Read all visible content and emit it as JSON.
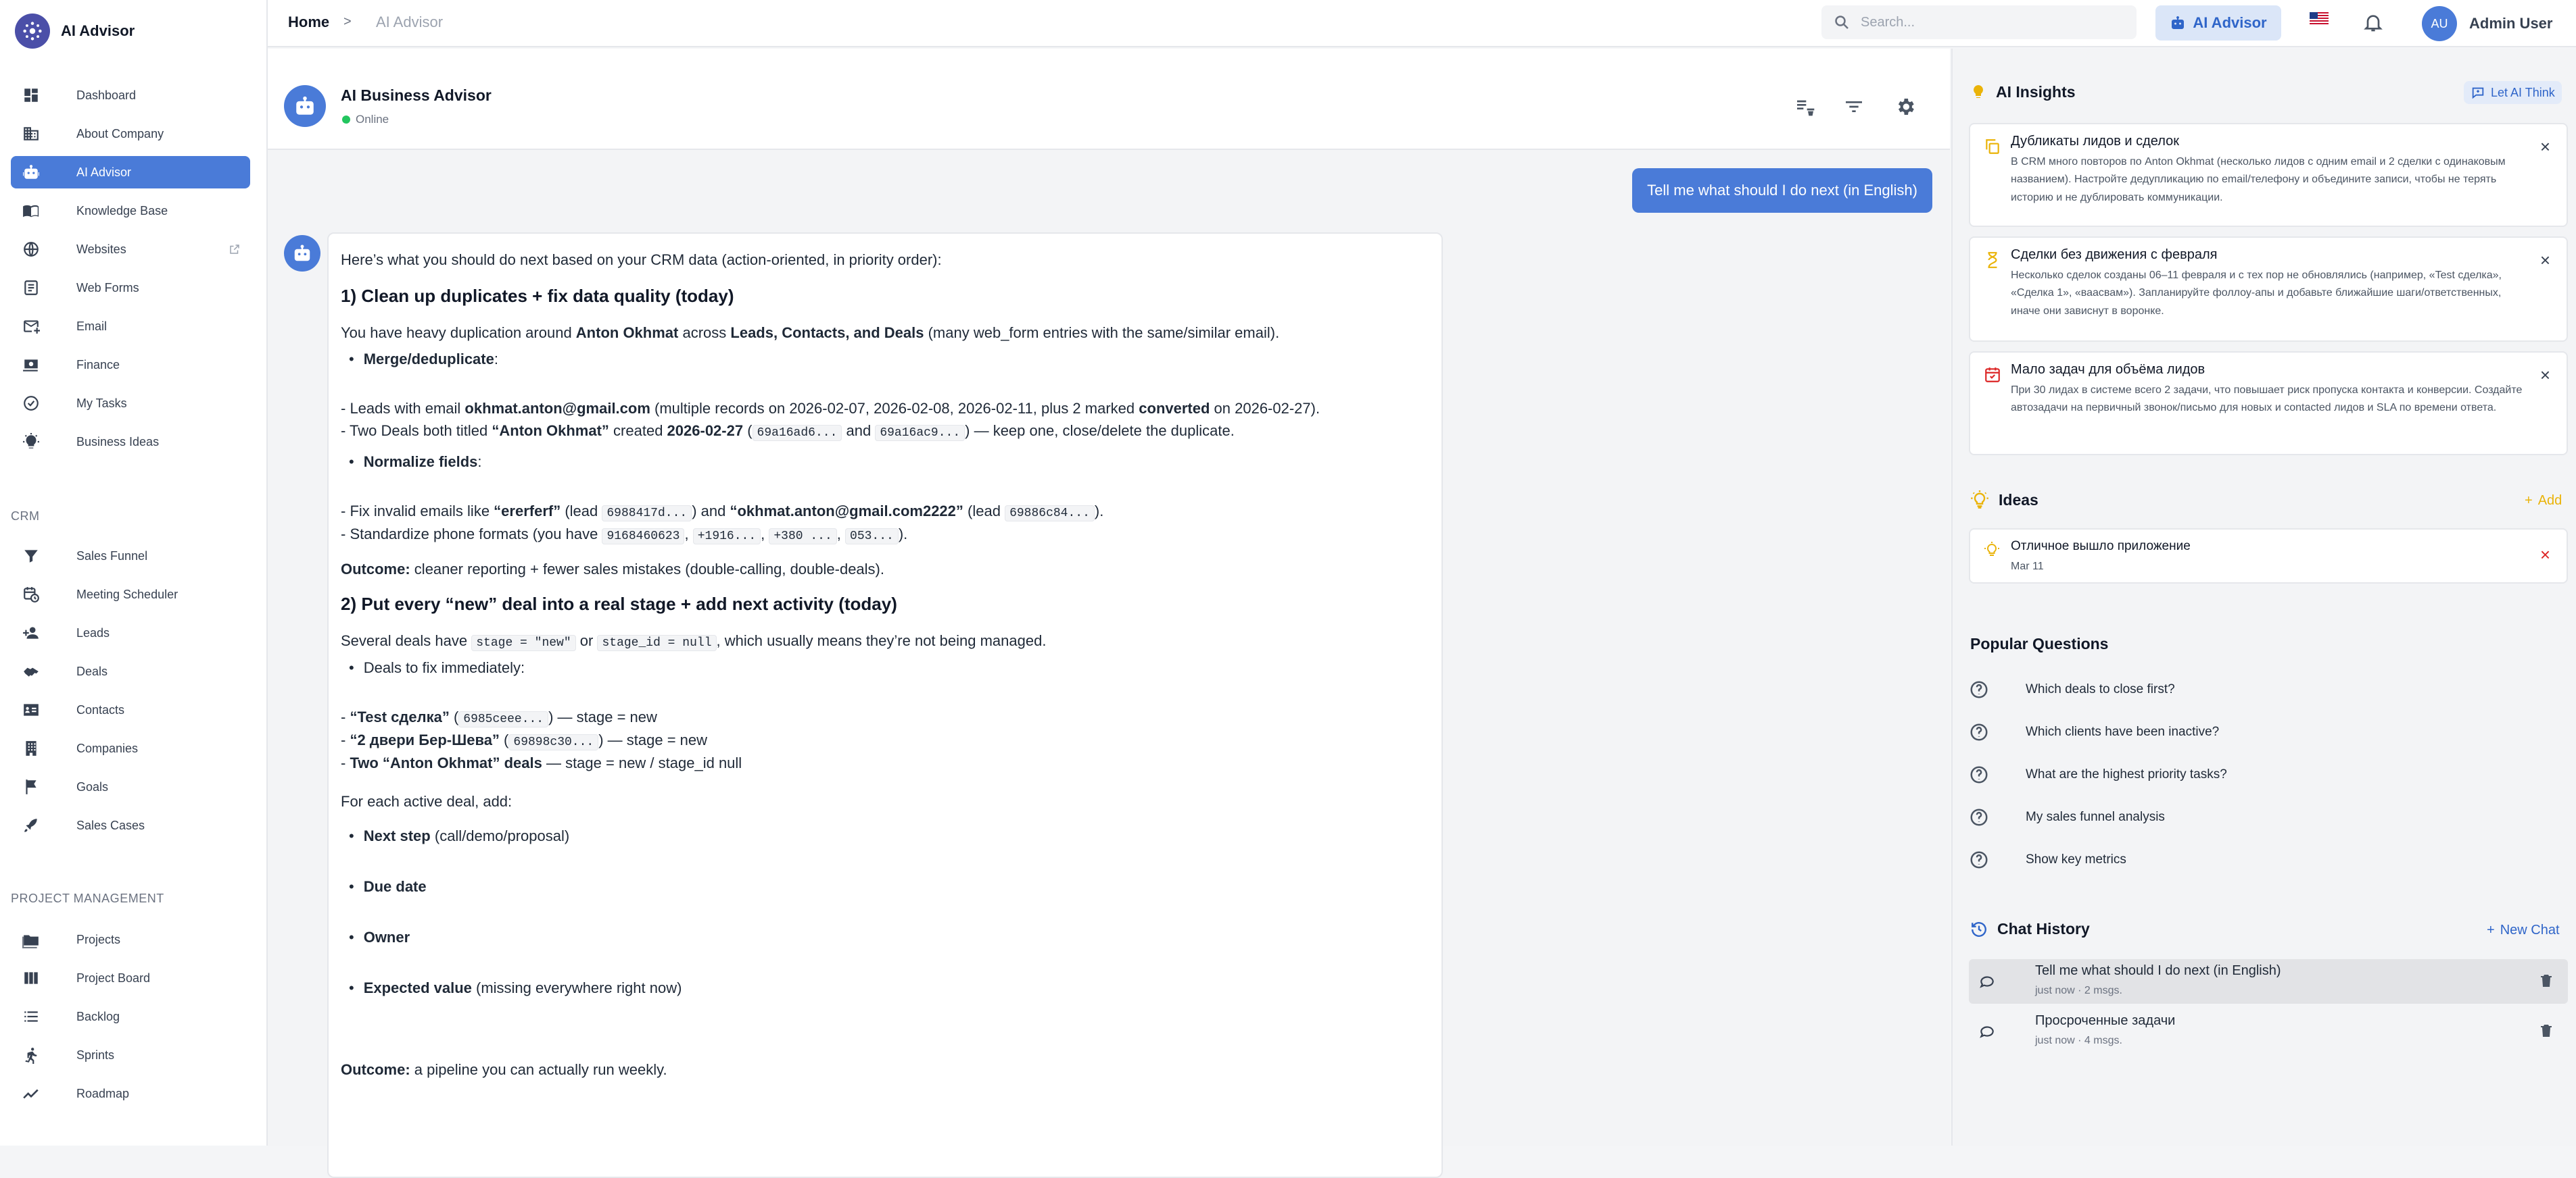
{
  "app": {
    "name": "AI Advisor"
  },
  "sidebar": {
    "items": [
      {
        "label": "Dashboard",
        "icon": "dashboard-icon"
      },
      {
        "label": "About Company",
        "icon": "building-icon"
      },
      {
        "label": "AI Advisor",
        "icon": "robot-icon",
        "active": true
      },
      {
        "label": "Knowledge Base",
        "icon": "book-icon"
      },
      {
        "label": "Websites",
        "icon": "globe-icon",
        "external": true
      },
      {
        "label": "Web Forms",
        "icon": "form-icon"
      },
      {
        "label": "Email",
        "icon": "email-icon"
      },
      {
        "label": "Finance",
        "icon": "money-icon"
      },
      {
        "label": "My Tasks",
        "icon": "check-circle-icon"
      },
      {
        "label": "Business Ideas",
        "icon": "lightbulb-icon"
      }
    ],
    "crm_title": "CRM",
    "crm_items": [
      {
        "label": "Sales Funnel",
        "icon": "funnel-icon"
      },
      {
        "label": "Meeting Scheduler",
        "icon": "calendar-clock-icon"
      },
      {
        "label": "Leads",
        "icon": "person-add-icon"
      },
      {
        "label": "Deals",
        "icon": "handshake-icon"
      },
      {
        "label": "Contacts",
        "icon": "contact-card-icon"
      },
      {
        "label": "Companies",
        "icon": "company-icon"
      },
      {
        "label": "Goals",
        "icon": "flag-icon"
      },
      {
        "label": "Sales Cases",
        "icon": "rocket-icon"
      }
    ],
    "pm_title": "PROJECT MANAGEMENT",
    "pm_items": [
      {
        "label": "Projects",
        "icon": "folder-icon"
      },
      {
        "label": "Project Board",
        "icon": "board-icon"
      },
      {
        "label": "Backlog",
        "icon": "list-icon"
      },
      {
        "label": "Sprints",
        "icon": "runner-icon"
      },
      {
        "label": "Roadmap",
        "icon": "trend-icon"
      }
    ]
  },
  "topbar": {
    "breadcrumb_home": "Home",
    "breadcrumb_sep": ">",
    "breadcrumb_current": "AI Advisor",
    "search_placeholder": "Search...",
    "ai_button": "AI Advisor",
    "avatar_initials": "AU",
    "user_name": "Admin User"
  },
  "chat": {
    "title": "AI Business Advisor",
    "status": "Online",
    "user_message": "Tell me what should I do next (in English)",
    "reply": {
      "intro": "Here’s what you should do next based on your CRM data (action-oriented, in priority order):",
      "h1": "1) Clean up duplicates + fix data quality (today)",
      "p1_a": "You have heavy duplication around ",
      "p1_b": "Anton Okhmat",
      "p1_c": " across ",
      "p1_d": "Leads, Contacts, and Deals",
      "p1_e": " (many web_form entries with the same/similar email).",
      "b_merge": "Merge/deduplicate",
      "b_merge_colon": ":",
      "l1_a": "- Leads with email ",
      "l1_b": "okhmat.anton@gmail.com",
      "l1_c": " (multiple records on 2026-02-07, 2026-02-08, 2026-02-11, plus 2 marked ",
      "l1_d": "converted",
      "l1_e": " on 2026-02-27).",
      "l2_a": "- Two Deals both titled ",
      "l2_b": "“Anton Okhmat”",
      "l2_c": " created ",
      "l2_d": "2026-02-27",
      "l2_e": " (",
      "l2_code1": "69a16ad6...",
      "l2_f": " and ",
      "l2_code2": "69a16ac9...",
      "l2_g": ") — keep one, close/delete the duplicate.",
      "b_norm": "Normalize fields",
      "b_norm_colon": ":",
      "l3_a": "- Fix invalid emails like ",
      "l3_b": "“ererferf”",
      "l3_c": " (lead ",
      "l3_code1": "6988417d...",
      "l3_d": ") and ",
      "l3_e": "“okhmat.anton@gmail.com2222”",
      "l3_f": " (lead ",
      "l3_code2": "69886c84...",
      "l3_g": ").",
      "l4_a": "- Standardize phone formats (you have ",
      "l4_code1": "9168460623",
      "l4_s1": ", ",
      "l4_code2": "+1916...",
      "l4_s2": ", ",
      "l4_code3": "+380 ...",
      "l4_s3": ", ",
      "l4_code4": "053...",
      "l4_b": ").",
      "o1_a": "Outcome:",
      "o1_b": " cleaner reporting + fewer sales mistakes (double-calling, double-deals).",
      "h2": "2) Put every “new” deal into a real stage + add next activity (today)",
      "p2_a": "Several deals have ",
      "p2_code1": "stage = \"new\"",
      "p2_b": " or ",
      "p2_code2": "stage_id = null",
      "p2_c": ", which usually means they’re not being managed.",
      "b_deals": "Deals to fix immediately:",
      "d1_a": "- ",
      "d1_b": "“Test сделка”",
      "d1_c": " (",
      "d1_code": "6985ceee...",
      "d1_d": ") — stage = new",
      "d2_a": "- ",
      "d2_b": "“2 двери Бер-Шева”",
      "d2_c": " (",
      "d2_code": "69898c30...",
      "d2_d": ") — stage = new",
      "d3_a": "- ",
      "d3_b": "Two “Anton Okhmat” deals",
      "d3_c": " — stage = new / stage_id null",
      "p3": "For each active deal, add:",
      "b_next_a": "Next step",
      "b_next_b": " (call/demo/proposal)",
      "b_due": "Due date",
      "b_owner": "Owner",
      "b_val_a": "Expected value",
      "b_val_b": " (missing everywhere right now)",
      "o2_a": "Outcome:",
      "o2_b": " a pipeline you can actually run weekly."
    }
  },
  "insights": {
    "title": "AI Insights",
    "action": "Let AI Think",
    "cards": [
      {
        "title": "Дубликаты лидов и сделок",
        "text": "В CRM много повторов по Anton Okhmat (несколько лидов с одним email и 2 сделки с одинаковым названием). Настройте дедупликацию по email/телефону и объедините записи, чтобы не терять историю и не дублировать коммуникации."
      },
      {
        "title": "Сделки без движения с февраля",
        "text": "Несколько сделок созданы 06–11 февраля и с тех пор не обновлялись (например, «Test сделка», «Сделка 1», «ваасвам»). Запланируйте фоллоу-апы и добавьте ближайшие шаги/ответственных, иначе они зависнут в воронке."
      },
      {
        "title": "Мало задач для объёма лидов",
        "text": "При 30 лидах в системе всего 2 задачи, что повышает риск пропуска контакта и конверсии. Создайте автозадачи на первичный звонок/письмо для новых и contacted лидов и SLA по времени ответа."
      }
    ]
  },
  "ideas": {
    "title": "Ideas",
    "action": "Add",
    "items": [
      {
        "title": "Отличное вышло приложение",
        "date": "Mar 11"
      }
    ]
  },
  "popular": {
    "title": "Popular Questions",
    "items": [
      "Which deals to close first?",
      "Which clients have been inactive?",
      "What are the highest priority tasks?",
      "My sales funnel analysis",
      "Show key metrics"
    ]
  },
  "history": {
    "title": "Chat History",
    "action": "New Chat",
    "items": [
      {
        "title": "Tell me what should I do next (in English)",
        "meta": "just now · 2 msgs."
      },
      {
        "title": "Просроченные задачи",
        "meta": "just now · 4 msgs."
      }
    ]
  },
  "colors": {
    "accent": "#4a7bd8",
    "online": "#22c55e",
    "warning": "#eab308",
    "danger": "#dc2626"
  }
}
